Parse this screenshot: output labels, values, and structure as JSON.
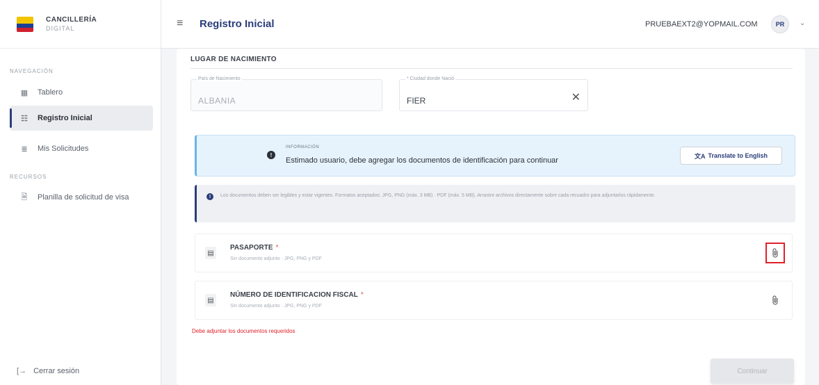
{
  "brand": {
    "name": "CANCILLERÍA",
    "subtitle": "DIGITAL"
  },
  "sidebar": {
    "section_nav": "NAVEGACIÓN",
    "items": [
      {
        "label": "Tablero",
        "icon": "dashboard-icon"
      },
      {
        "label": "Registro Inicial",
        "icon": "register-icon",
        "active": true
      },
      {
        "label": "Mis Solicitudes",
        "icon": "list-icon"
      }
    ],
    "section_resources": "RECURSOS",
    "resources": [
      {
        "label": "Planilla de solicitud de visa",
        "icon": "document-icon"
      }
    ],
    "logout": "Cerrar sesión"
  },
  "header": {
    "title": "Registro Inicial",
    "email": "PRUEBAEXT2@YOPMAIL.COM",
    "avatar_initials": "PR"
  },
  "form": {
    "section_title": "LUGAR DE NACIMIENTO",
    "country": {
      "label": "País de Nacimiento",
      "value": "ALBANIA"
    },
    "city": {
      "label": "* Ciudad donde Nació",
      "value": "FIER"
    }
  },
  "info": {
    "label": "INFORMACIÓN",
    "message": "Estimado usuario, debe agregar los documentos de identificación para continuar",
    "translate_button": "Translate to English"
  },
  "note": "Los documentos deben ser legibles y estar vigentes. Formatos aceptados: JPG, PNG (máx. 3 MB) · PDF (máx. 5 MB). Arrastre archivos directamente sobre cada recuadro para adjuntarlos rápidamente.",
  "documents": [
    {
      "name": "PASAPORTE",
      "status": "Sin documento adjunto · JPG, PNG y PDF",
      "required": "*"
    },
    {
      "name": "NÚMERO DE IDENTIFICACION FISCAL",
      "status": "Sin documento adjunto · JPG, PNG y PDF",
      "required": "*"
    }
  ],
  "error": "Debe adjuntar los documentos requeridos",
  "continue_button": "Continuar",
  "colors": {
    "primary": "#2b3d7a",
    "info_bg": "#e7f3fc",
    "error": "#e0202a",
    "highlight": "#e0202a"
  }
}
